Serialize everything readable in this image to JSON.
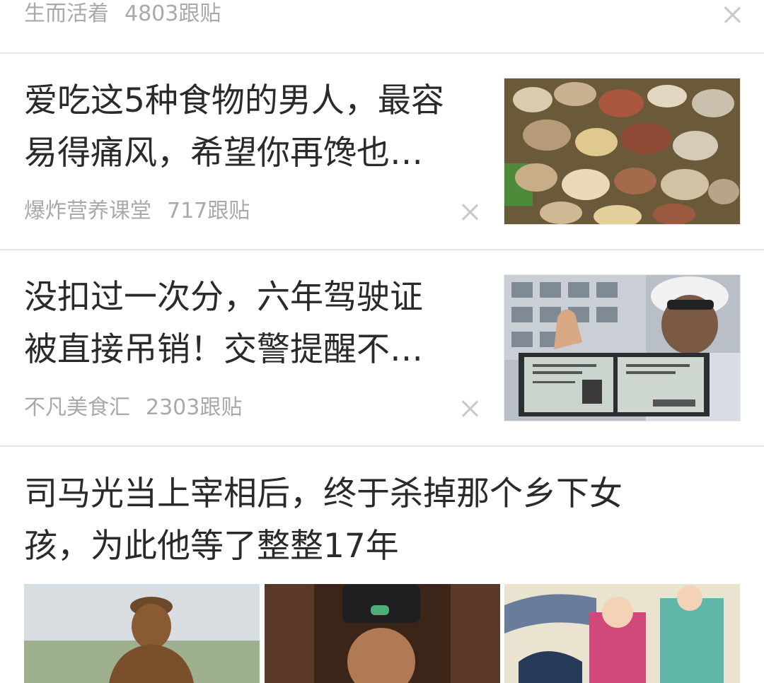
{
  "feed": {
    "top": {
      "source": "生而活着",
      "replies": "4803跟贴"
    },
    "item1": {
      "title_line1": "爱吃这5种食物的男人，最容",
      "title_line2": "易得痛风，希望你再馋也…",
      "source": "爆炸营养课堂",
      "replies": "717跟贴",
      "image_desc": "clams-photo"
    },
    "item2": {
      "title_line1": "没扣过一次分，六年驾驶证",
      "title_line2": "被直接吊销！交警提醒不…",
      "source": "不凡美食汇",
      "replies": "2303跟贴",
      "image_desc": "traffic-police-license-photo"
    },
    "item3": {
      "title_line1": "司马光当上宰相后，终于杀掉那个乡下女",
      "title_line2": "孩，为此他等了整整17年",
      "images": [
        "statue-photo",
        "actor-in-hat-photo",
        "cartoon-illustration"
      ]
    }
  }
}
